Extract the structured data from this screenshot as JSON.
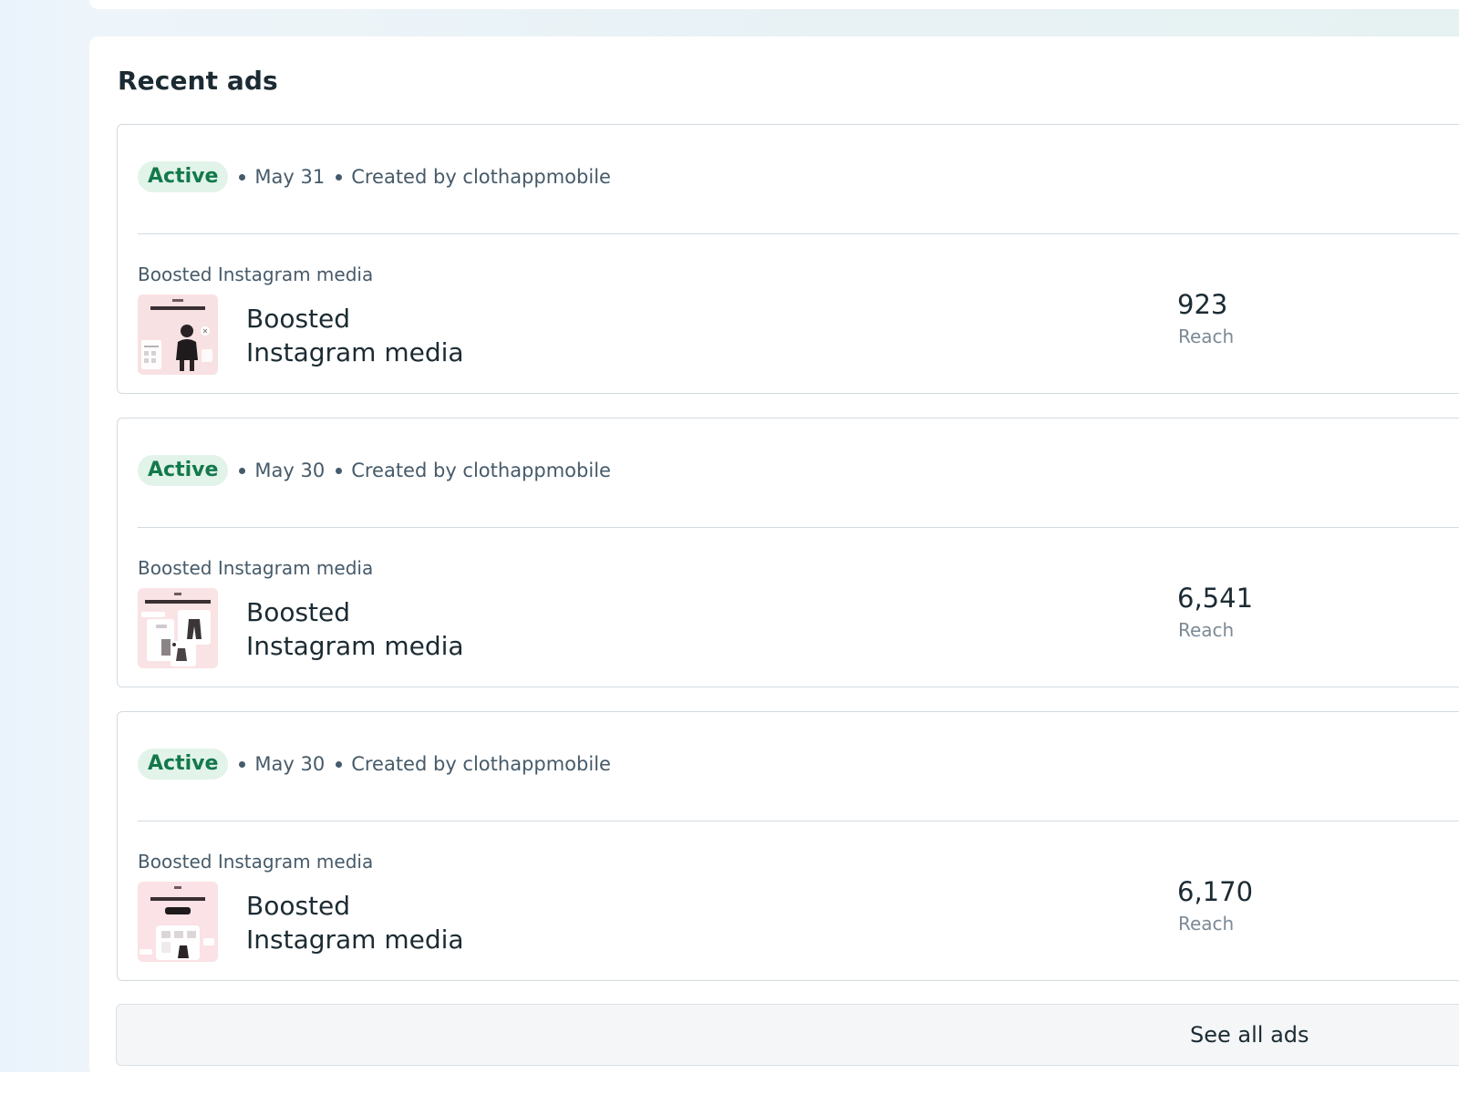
{
  "section": {
    "title": "Recent ads"
  },
  "ads": [
    {
      "status": "Active",
      "date": "May 31",
      "created_by": "Created by clothappmobile",
      "type": "Boosted Instagram media",
      "name_line1": "Boosted",
      "name_line2": "Instagram media",
      "metric_value": "923",
      "metric_label": "Reach",
      "thumbnail_icon": "person-in-tshirt-creative"
    },
    {
      "status": "Active",
      "date": "May 30",
      "created_by": "Created by clothappmobile",
      "type": "Boosted Instagram media",
      "name_line1": "Boosted",
      "name_line2": "Instagram media",
      "metric_value": "6,541",
      "metric_label": "Reach",
      "thumbnail_icon": "outfit-cards-creative"
    },
    {
      "status": "Active",
      "date": "May 30",
      "created_by": "Created by clothappmobile",
      "type": "Boosted Instagram media",
      "name_line1": "Boosted",
      "name_line2": "Instagram media",
      "metric_value": "6,170",
      "metric_label": "Reach",
      "thumbnail_icon": "virtual-stylist-creative"
    }
  ],
  "footer": {
    "see_all_label": "See all ads"
  },
  "colors": {
    "active_badge_bg": "#e2f3ea",
    "active_badge_text": "#13794b",
    "primary_text": "#1c2b33",
    "secondary_text": "#465a69"
  }
}
